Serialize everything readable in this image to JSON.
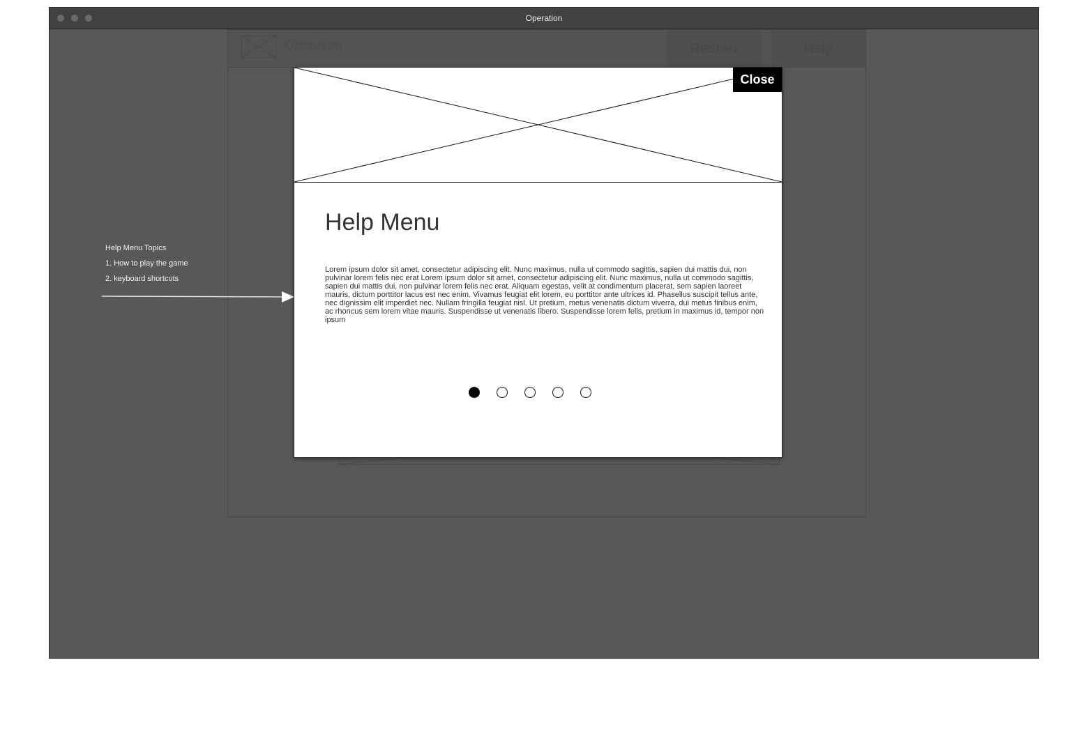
{
  "window": {
    "title": "Operation"
  },
  "header": {
    "app_name": "Operation",
    "restart_label": "Restart",
    "help_label": "Help"
  },
  "annotation": {
    "heading": "Help Menu Topics",
    "items": [
      "1. How to play the game",
      "2. keyboard shortcuts"
    ]
  },
  "modal": {
    "close_label": "Close",
    "title": "Help Menu",
    "body": "Lorem ipsum dolor sit amet, consectetur adipiscing elit. Nunc maximus, nulla ut commodo sagittis, sapien dui mattis dui, non pulvinar lorem felis nec erat Lorem ipsum dolor sit amet, consectetur adipiscing elit. Nunc maximus, nulla ut commodo sagittis, sapien dui mattis dui, non pulvinar lorem felis nec erat. Aliquam egestas, velit at condimentum placerat, sem sapien laoreet mauris, dictum porttitor lacus est nec enim. Vivamus feugiat elit lorem, eu porttitor ante ultrices id. Phasellus suscipit tellus ante, nec dignissim elit imperdiet nec. Nullam fringilla feugiat nisl. Ut pretium, metus venenatis dictum viverra, dui metus finibus enim, ac rhoncus sem lorem vitae mauris. Suspendisse ut venenatis libero. Suspendisse lorem felis, pretium in maximus id, tempor non ipsum",
    "pagination": {
      "total": 5,
      "active_index": 0
    }
  },
  "colors": {
    "window_bg": "#585858",
    "titlebar_bg": "#414141",
    "modal_bg": "#ffffff",
    "close_bg": "#000000"
  }
}
